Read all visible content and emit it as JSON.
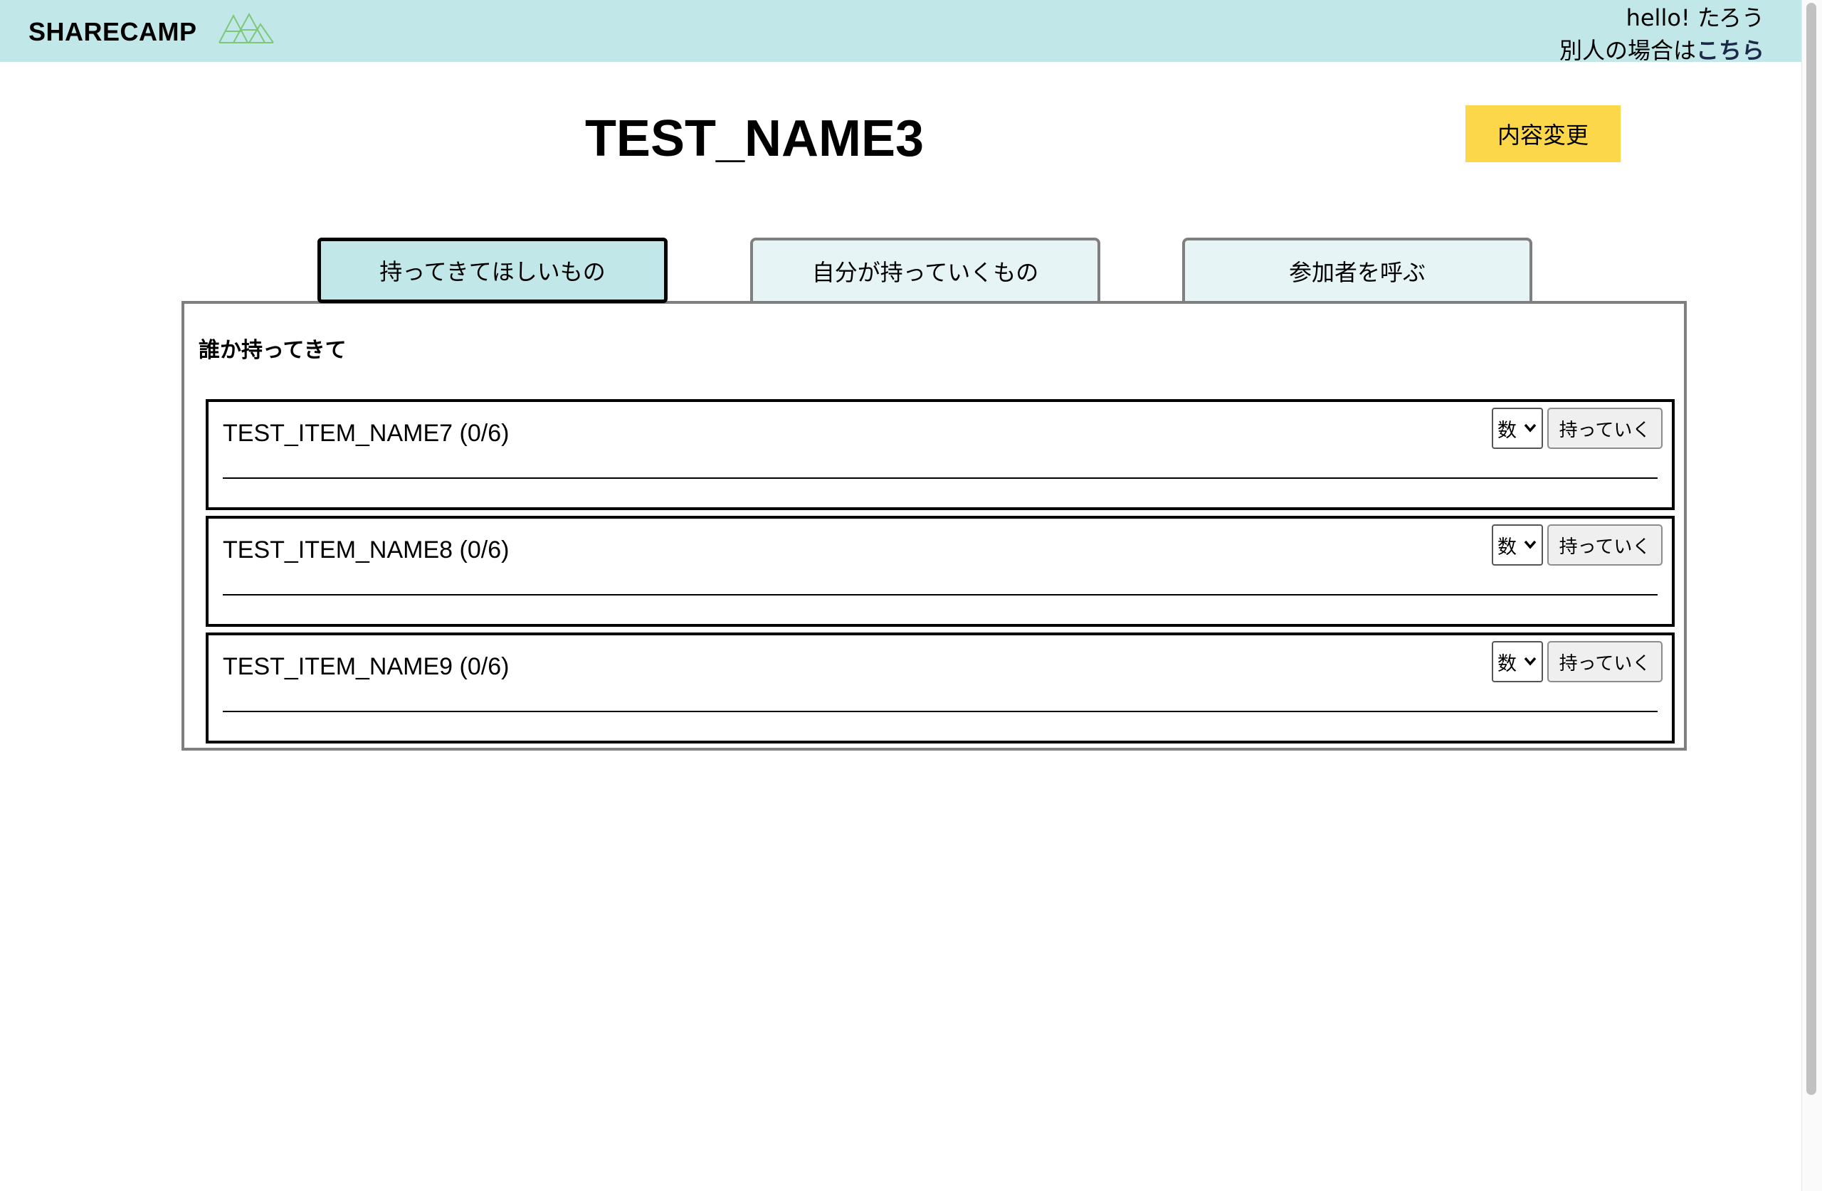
{
  "header": {
    "logo_text": "SHARECAMP",
    "logo_icon": "mountain-icon",
    "greeting": "hello! たろう",
    "switch_prefix": "別人の場合は",
    "switch_link": "こちら",
    "bg_color": "#c2e7e8"
  },
  "main": {
    "title": "TEST_NAME3",
    "edit_label": "内容変更",
    "edit_color": "#fbd749"
  },
  "tabs": [
    {
      "label": "持ってきてほしいもの",
      "active": true
    },
    {
      "label": "自分が持っていくもの",
      "active": false
    },
    {
      "label": "参加者を呼ぶ",
      "active": false
    }
  ],
  "panel": {
    "section_title": "誰か持ってきて",
    "items": [
      {
        "name": "TEST_ITEM_NAME7 (0/6)",
        "select_value": "数",
        "action_label": "持っていく"
      },
      {
        "name": "TEST_ITEM_NAME8 (0/6)",
        "select_value": "数",
        "action_label": "持っていく"
      },
      {
        "name": "TEST_ITEM_NAME9 (0/6)",
        "select_value": "数",
        "action_label": "持っていく"
      }
    ]
  }
}
